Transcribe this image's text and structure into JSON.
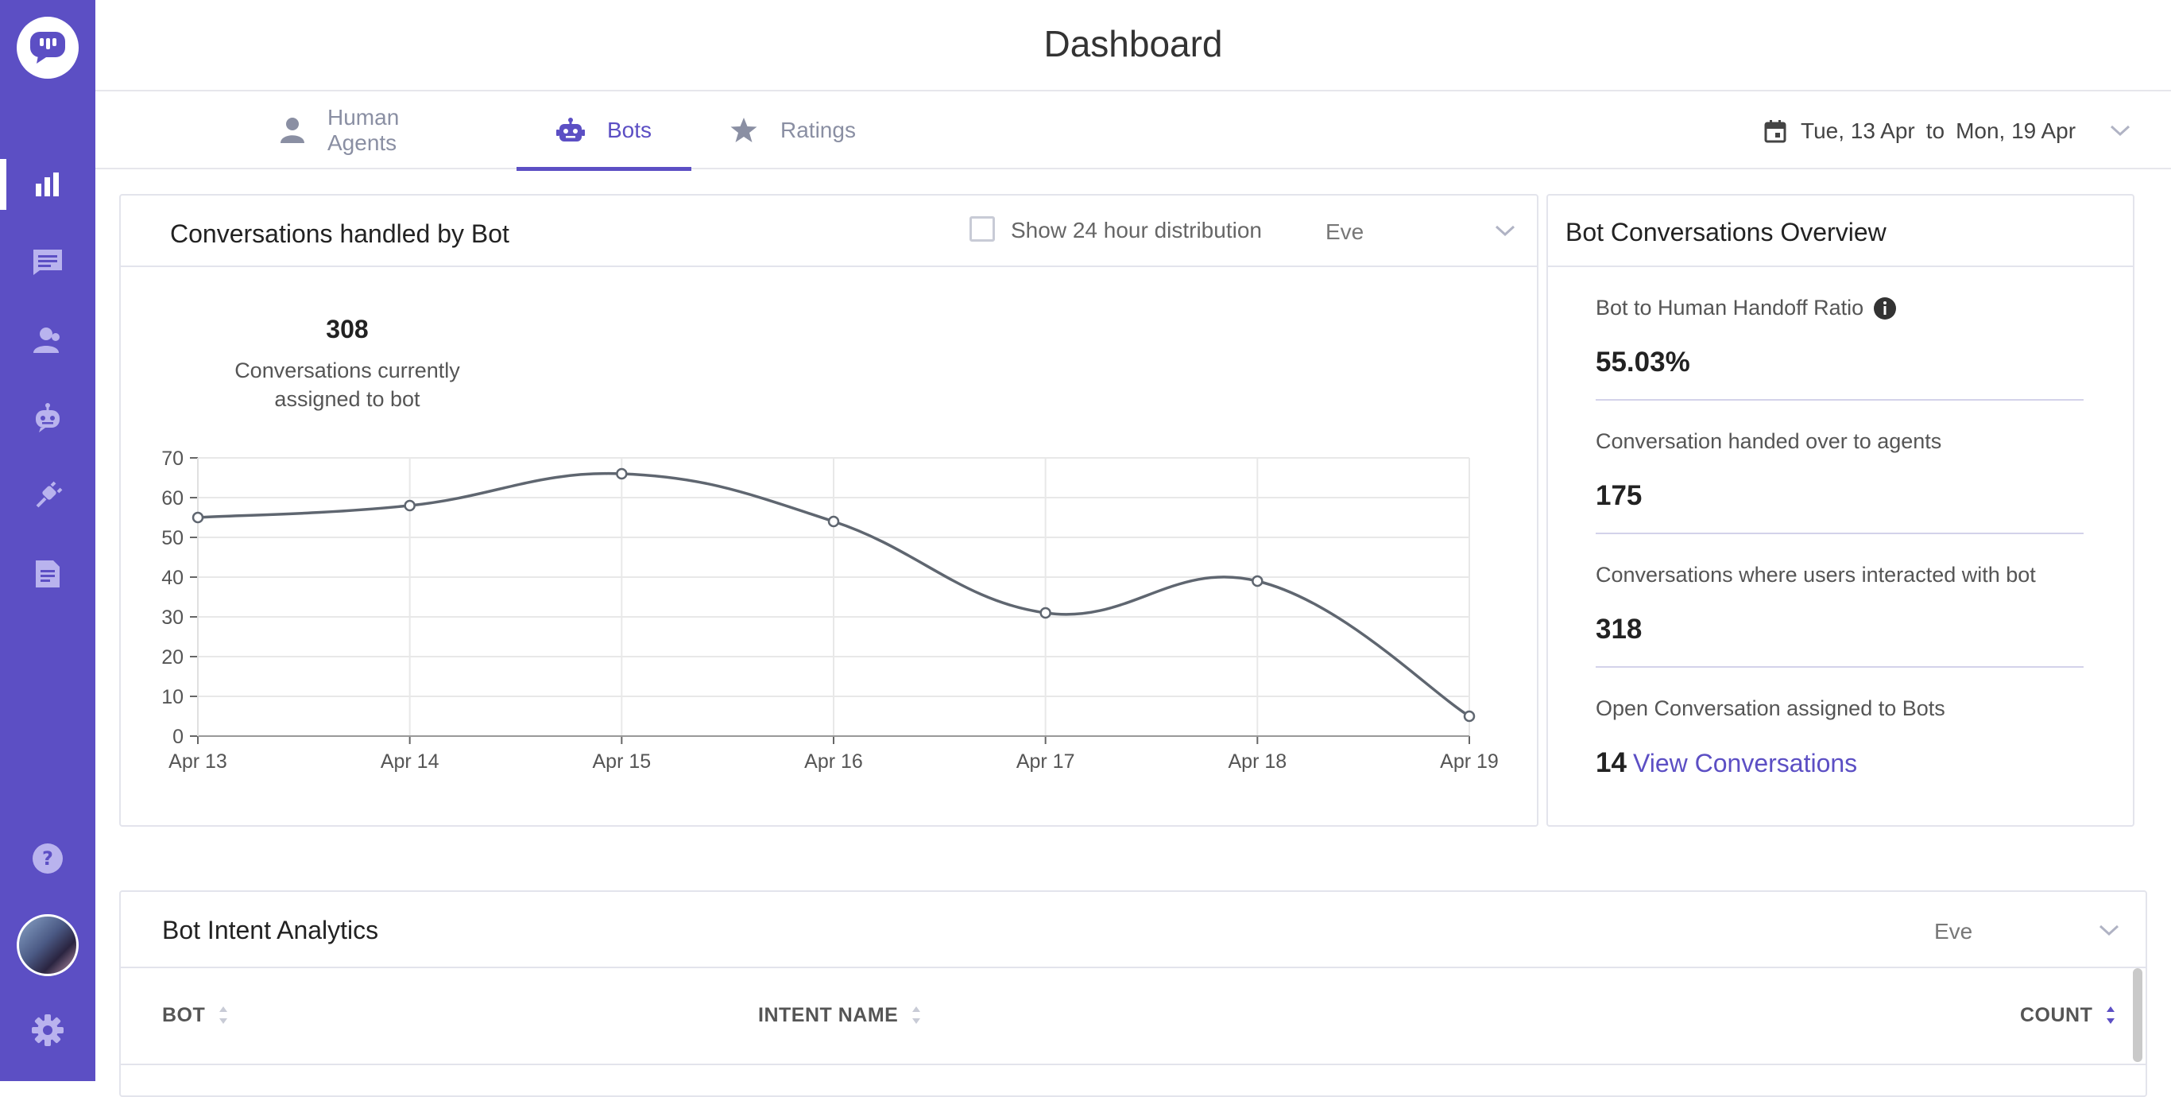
{
  "app": {
    "title": "Dashboard"
  },
  "tabs": [
    {
      "label": "Human Agents",
      "icon": "person-icon",
      "active": false
    },
    {
      "label": "Bots",
      "icon": "bot-icon",
      "active": true
    },
    {
      "label": "Ratings",
      "icon": "star-icon",
      "active": false
    }
  ],
  "date_range": {
    "from": "Tue, 13 Apr",
    "sep": "to",
    "to": "Mon, 19 Apr"
  },
  "conversations_card": {
    "title": "Conversations handled by Bot",
    "checkbox_label": "Show 24 hour distribution",
    "bot_select": "Eve",
    "count": "308",
    "count_caption_line1": "Conversations currently",
    "count_caption_line2": "assigned to bot"
  },
  "chart_data": {
    "type": "line",
    "x": [
      "Apr 13",
      "Apr 14",
      "Apr 15",
      "Apr 16",
      "Apr 17",
      "Apr 18",
      "Apr 19"
    ],
    "series": [
      {
        "values": [
          55,
          58,
          66,
          54,
          31,
          39,
          5
        ]
      }
    ],
    "ylim": [
      0,
      70
    ],
    "yticks": [
      0,
      10,
      20,
      30,
      40,
      50,
      60,
      70
    ],
    "grid": true,
    "colors": {
      "line": "#5f6670",
      "grid": "#e8e8e8"
    }
  },
  "overview": {
    "title": "Bot Conversations Overview",
    "ratio_label": "Bot to Human Handoff Ratio",
    "ratio_value": "55.03%",
    "handed_label": "Conversation handed over to agents",
    "handed_value": "175",
    "interacted_label": "Conversations where users interacted with bot",
    "interacted_value": "318",
    "open_label": "Open Conversation assigned to Bots",
    "open_value": "14",
    "open_link": "View Conversations"
  },
  "intent_card": {
    "title": "Bot Intent Analytics",
    "bot_select": "Eve",
    "columns": [
      "BOT",
      "INTENT NAME",
      "COUNT"
    ]
  },
  "colors": {
    "brand": "#5c4fc4",
    "sidebar_icon": "#b9b3ee"
  }
}
